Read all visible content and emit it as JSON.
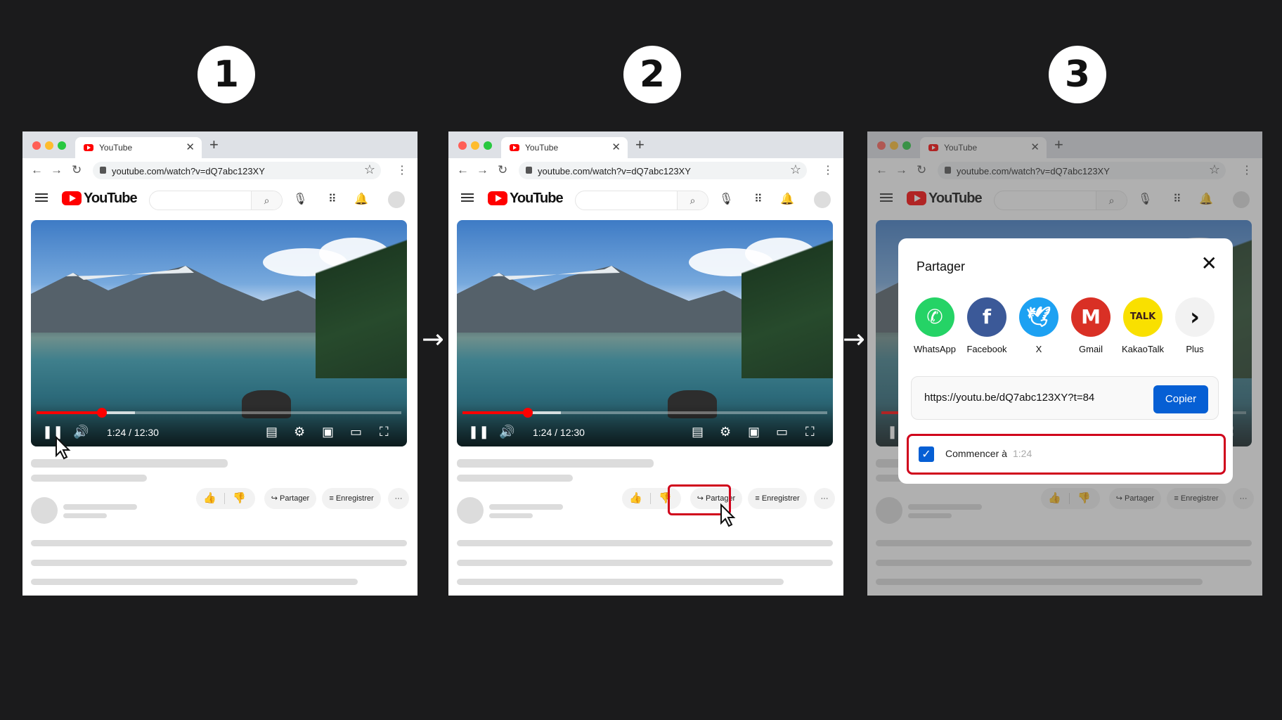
{
  "steps": [
    "1",
    "2",
    "3"
  ],
  "arrows": [
    "→",
    "→"
  ],
  "browser": {
    "tab_title": "YouTube",
    "url": "youtube.com/watch?v=dQ7abc123XY",
    "new_tab_symbol": "+"
  },
  "youtube": {
    "logo_text": "YouTube",
    "time_display": "1:24 / 12:30",
    "progress_fraction": 0.18,
    "buttons": {
      "share": "Partager",
      "save": "Enregistrer",
      "more": "···"
    }
  },
  "share_dialog": {
    "title": "Partager",
    "close_symbol": "✕",
    "targets": [
      {
        "label": "WhatsApp",
        "icon": "whatsapp-icon",
        "color": "#25d366",
        "glyph": "✆"
      },
      {
        "label": "Facebook",
        "icon": "facebook-icon",
        "color": "#3b5998",
        "glyph": "f"
      },
      {
        "label": "X",
        "icon": "twitter-icon",
        "color": "#1da1f2",
        "glyph": "🕊"
      },
      {
        "label": "Gmail",
        "icon": "gmail-icon",
        "color": "#d93025",
        "glyph": "M"
      },
      {
        "label": "KakaoTalk",
        "icon": "kakaotalk-icon",
        "color": "#f9e000",
        "glyph": "TALK"
      },
      {
        "label": "Plus",
        "icon": "chevron-right-icon",
        "color": "#f2f2f2",
        "glyph": "›"
      }
    ],
    "link": "https://youtu.be/dQ7abc123XY?t=84",
    "copy_label": "Copier",
    "start_label": "Commencer à",
    "start_time": "1:24",
    "start_checked": true
  },
  "colors": {
    "highlight": "#d0021b",
    "accent": "#065fd4",
    "progress": "#ff0000"
  }
}
